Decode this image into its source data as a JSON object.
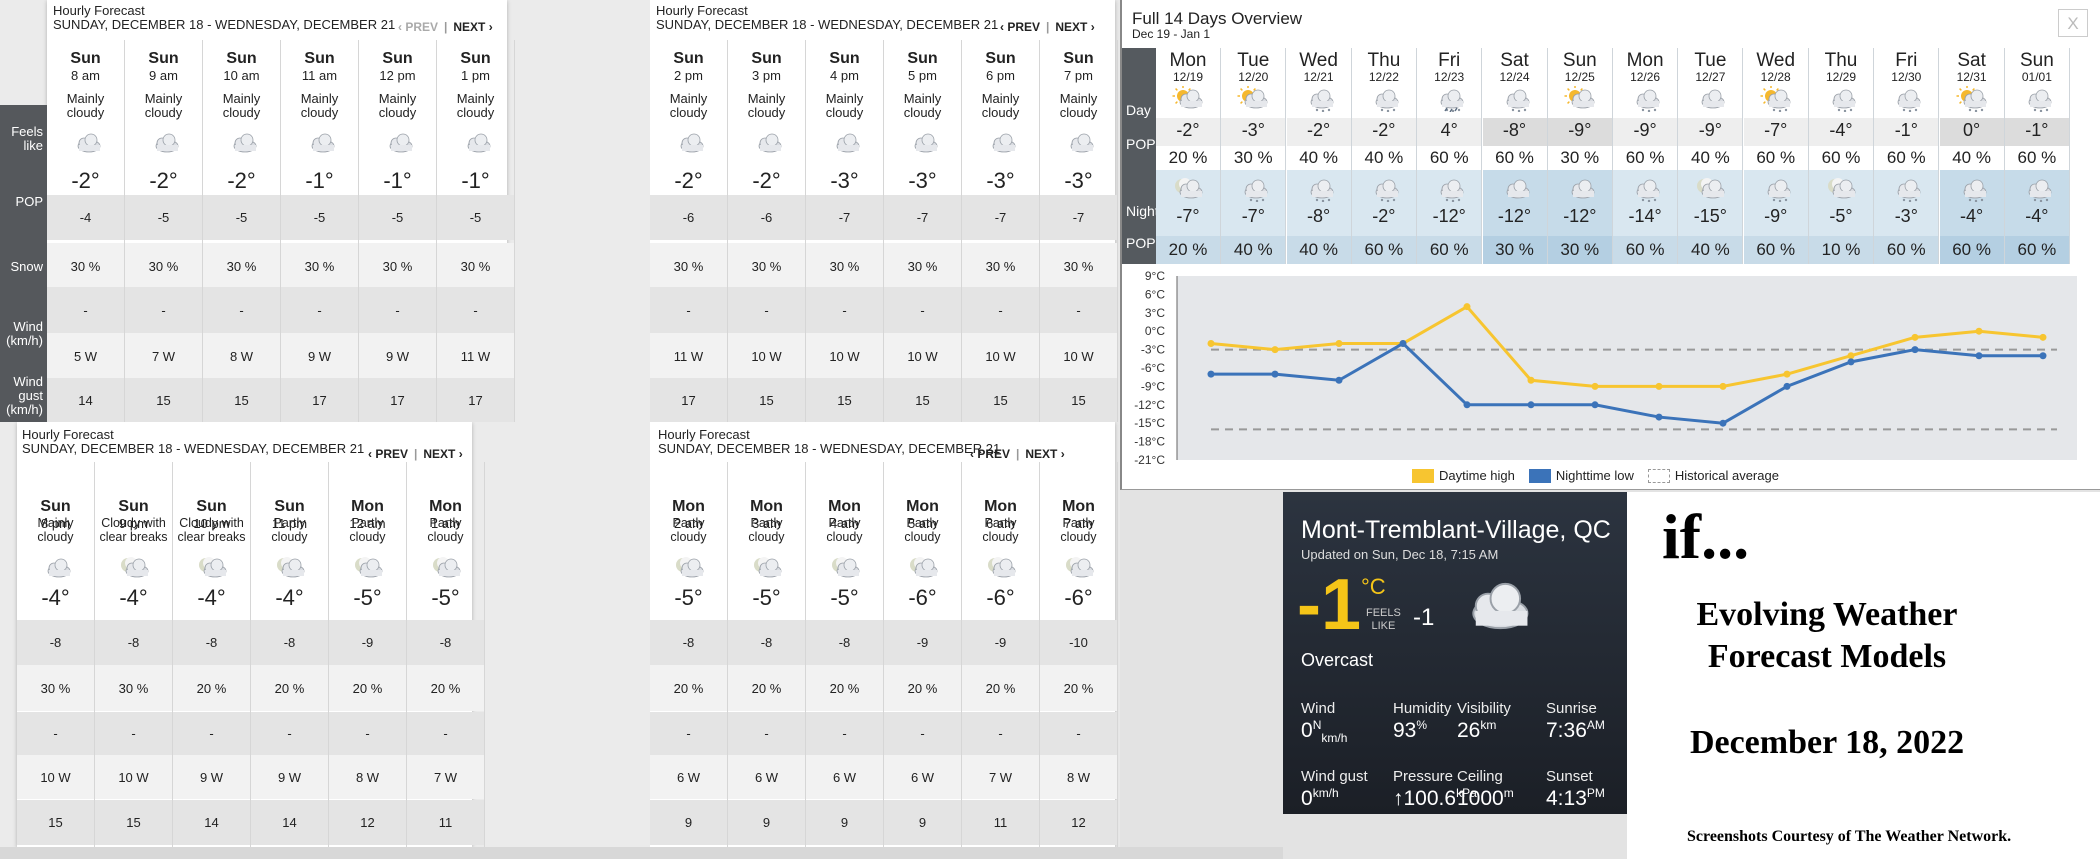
{
  "hourly_panels": [
    {
      "title": "Hourly Forecast",
      "date_range": "SUNDAY, DECEMBER 18 - WEDNESDAY, DECEMBER 21",
      "prev": "‹ PREV",
      "next": "NEXT ›",
      "prev_dim": true,
      "cols": [
        {
          "day": "Sun",
          "time": "8 am",
          "cond": [
            "Mainly",
            "cloudy"
          ],
          "temp": "-2°",
          "feels": "-4",
          "pop": "30 %",
          "snow": "-",
          "wind": "5 W",
          "gust": "14",
          "icon": "cloud-icon"
        },
        {
          "day": "Sun",
          "time": "9 am",
          "cond": [
            "Mainly",
            "cloudy"
          ],
          "temp": "-2°",
          "feels": "-5",
          "pop": "30 %",
          "snow": "-",
          "wind": "7 W",
          "gust": "15",
          "icon": "cloud-icon"
        },
        {
          "day": "Sun",
          "time": "10 am",
          "cond": [
            "Mainly",
            "cloudy"
          ],
          "temp": "-2°",
          "feels": "-5",
          "pop": "30 %",
          "snow": "-",
          "wind": "8 W",
          "gust": "15",
          "icon": "cloud-icon"
        },
        {
          "day": "Sun",
          "time": "11 am",
          "cond": [
            "Mainly",
            "cloudy"
          ],
          "temp": "-1°",
          "feels": "-5",
          "pop": "30 %",
          "snow": "-",
          "wind": "9 W",
          "gust": "17",
          "icon": "cloud-icon"
        },
        {
          "day": "Sun",
          "time": "12 pm",
          "cond": [
            "Mainly",
            "cloudy"
          ],
          "temp": "-1°",
          "feels": "-5",
          "pop": "30 %",
          "snow": "-",
          "wind": "9 W",
          "gust": "17",
          "icon": "cloud-icon"
        },
        {
          "day": "Sun",
          "time": "1 pm",
          "cond": [
            "Mainly",
            "cloudy"
          ],
          "temp": "-1°",
          "feels": "-5",
          "pop": "30 %",
          "snow": "-",
          "wind": "11 W",
          "gust": "17",
          "icon": "cloud-icon"
        }
      ]
    },
    {
      "title": "Hourly Forecast",
      "date_range": "SUNDAY, DECEMBER 18 - WEDNESDAY, DECEMBER 21",
      "prev": "‹ PREV",
      "next": "NEXT ›",
      "prev_dim": false,
      "cols": [
        {
          "day": "Sun",
          "time": "2 pm",
          "cond": [
            "Mainly",
            "cloudy"
          ],
          "temp": "-2°",
          "feels": "-6",
          "pop": "30 %",
          "snow": "-",
          "wind": "11 W",
          "gust": "17",
          "icon": "cloud-icon"
        },
        {
          "day": "Sun",
          "time": "3 pm",
          "cond": [
            "Mainly",
            "cloudy"
          ],
          "temp": "-2°",
          "feels": "-6",
          "pop": "30 %",
          "snow": "-",
          "wind": "10 W",
          "gust": "15",
          "icon": "cloud-icon"
        },
        {
          "day": "Sun",
          "time": "4 pm",
          "cond": [
            "Mainly",
            "cloudy"
          ],
          "temp": "-3°",
          "feels": "-7",
          "pop": "30 %",
          "snow": "-",
          "wind": "10 W",
          "gust": "15",
          "icon": "cloud-icon"
        },
        {
          "day": "Sun",
          "time": "5 pm",
          "cond": [
            "Mainly",
            "cloudy"
          ],
          "temp": "-3°",
          "feels": "-7",
          "pop": "30 %",
          "snow": "-",
          "wind": "10 W",
          "gust": "15",
          "icon": "cloud-icon"
        },
        {
          "day": "Sun",
          "time": "6 pm",
          "cond": [
            "Mainly",
            "cloudy"
          ],
          "temp": "-3°",
          "feels": "-7",
          "pop": "30 %",
          "snow": "-",
          "wind": "10 W",
          "gust": "15",
          "icon": "cloud-icon"
        },
        {
          "day": "Sun",
          "time": "7 pm",
          "cond": [
            "Mainly",
            "cloudy"
          ],
          "temp": "-3°",
          "feels": "-7",
          "pop": "30 %",
          "snow": "-",
          "wind": "10 W",
          "gust": "15",
          "icon": "cloud-icon"
        }
      ]
    },
    {
      "title": "Hourly Forecast",
      "date_range": "SUNDAY, DECEMBER 18 - WEDNESDAY, DECEMBER 21",
      "prev": "‹ PREV",
      "next": "NEXT ›",
      "prev_dim": false,
      "cols": [
        {
          "day": "Sun",
          "time": "8 pm",
          "cond": [
            "Mainly",
            "cloudy"
          ],
          "temp": "-4°",
          "feels": "-8",
          "pop": "30 %",
          "snow": "-",
          "wind": "10 W",
          "gust": "15",
          "icon": "cloud-icon"
        },
        {
          "day": "Sun",
          "time": "9 pm",
          "cond": [
            "Cloudy with",
            "clear breaks"
          ],
          "temp": "-4°",
          "feels": "-8",
          "pop": "30 %",
          "snow": "-",
          "wind": "10 W",
          "gust": "15",
          "icon": "moon-cloud-icon"
        },
        {
          "day": "Sun",
          "time": "10 pm",
          "cond": [
            "Cloudy with",
            "clear breaks"
          ],
          "temp": "-4°",
          "feels": "-8",
          "pop": "20 %",
          "snow": "-",
          "wind": "9 W",
          "gust": "14",
          "icon": "moon-cloud-icon"
        },
        {
          "day": "Sun",
          "time": "11 pm",
          "cond": [
            "Partly",
            "cloudy"
          ],
          "temp": "-4°",
          "feels": "-8",
          "pop": "20 %",
          "snow": "-",
          "wind": "9 W",
          "gust": "14",
          "icon": "moon-cloud-icon"
        },
        {
          "day": "Mon",
          "time": "12 am",
          "cond": [
            "Partly",
            "cloudy"
          ],
          "temp": "-5°",
          "feels": "-9",
          "pop": "20 %",
          "snow": "-",
          "wind": "8 W",
          "gust": "12",
          "icon": "moon-cloud-icon"
        },
        {
          "day": "Mon",
          "time": "1 am",
          "cond": [
            "Partly",
            "cloudy"
          ],
          "temp": "-5°",
          "feels": "-8",
          "pop": "20 %",
          "snow": "-",
          "wind": "7 W",
          "gust": "11",
          "icon": "moon-cloud-icon"
        }
      ]
    },
    {
      "title": "Hourly Forecast",
      "date_range": "SUNDAY, DECEMBER 18 - WEDNESDAY, DECEMBER 21",
      "prev": "‹ PREV",
      "next": "NEXT ›",
      "prev_dim": false,
      "cols": [
        {
          "day": "Mon",
          "time": "2 am",
          "cond": [
            "Partly",
            "cloudy"
          ],
          "temp": "-5°",
          "feels": "-8",
          "pop": "20 %",
          "snow": "-",
          "wind": "6 W",
          "gust": "9",
          "icon": "moon-cloud-icon"
        },
        {
          "day": "Mon",
          "time": "3 am",
          "cond": [
            "Partly",
            "cloudy"
          ],
          "temp": "-5°",
          "feels": "-8",
          "pop": "20 %",
          "snow": "-",
          "wind": "6 W",
          "gust": "9",
          "icon": "moon-cloud-icon"
        },
        {
          "day": "Mon",
          "time": "4 am",
          "cond": [
            "Partly",
            "cloudy"
          ],
          "temp": "-5°",
          "feels": "-8",
          "pop": "20 %",
          "snow": "-",
          "wind": "6 W",
          "gust": "9",
          "icon": "moon-cloud-icon"
        },
        {
          "day": "Mon",
          "time": "5 am",
          "cond": [
            "Partly",
            "cloudy"
          ],
          "temp": "-6°",
          "feels": "-9",
          "pop": "20 %",
          "snow": "-",
          "wind": "6 W",
          "gust": "9",
          "icon": "moon-cloud-icon"
        },
        {
          "day": "Mon",
          "time": "6 am",
          "cond": [
            "Partly",
            "cloudy"
          ],
          "temp": "-6°",
          "feels": "-9",
          "pop": "20 %",
          "snow": "-",
          "wind": "7 W",
          "gust": "11",
          "icon": "moon-cloud-icon"
        },
        {
          "day": "Mon",
          "time": "7 am",
          "cond": [
            "Partly",
            "cloudy"
          ],
          "temp": "-6°",
          "feels": "-10",
          "pop": "20 %",
          "snow": "-",
          "wind": "8 W",
          "gust": "12",
          "icon": "moon-cloud-icon"
        }
      ]
    }
  ],
  "row_labels": {
    "feels": [
      "Feels",
      "like"
    ],
    "pop": "POP",
    "snow": "Snow",
    "wind": [
      "Wind",
      "(km/h)"
    ],
    "gust": [
      "Wind",
      "gust",
      "(km/h)"
    ]
  },
  "overview": {
    "title": "Full 14 Days Overview",
    "subtitle": "Dec 19 - Jan 1",
    "close": "X",
    "day_label": "Day",
    "night_label": "Night",
    "pop_label": "POP",
    "days": [
      {
        "dn": "Mon",
        "dt": "12/19",
        "hi": "-2°",
        "dpop": "20 %",
        "lo": "-7°",
        "npop": "20 %",
        "dicon": "sun-cloud-icon",
        "nicon": "moon-cloud-icon"
      },
      {
        "dn": "Tue",
        "dt": "12/20",
        "hi": "-3°",
        "dpop": "30 %",
        "lo": "-7°",
        "npop": "40 %",
        "dicon": "sun-cloud-icon",
        "nicon": "snow-cloud-icon"
      },
      {
        "dn": "Wed",
        "dt": "12/21",
        "hi": "-2°",
        "dpop": "40 %",
        "lo": "-8°",
        "npop": "40 %",
        "dicon": "snow-cloud-icon",
        "nicon": "snow-cloud-icon"
      },
      {
        "dn": "Thu",
        "dt": "12/22",
        "hi": "-2°",
        "dpop": "40 %",
        "lo": "-2°",
        "npop": "60 %",
        "dicon": "snow-cloud-icon",
        "nicon": "snow-cloud-icon"
      },
      {
        "dn": "Fri",
        "dt": "12/23",
        "hi": "4°",
        "dpop": "60 %",
        "lo": "-12°",
        "npop": "60 %",
        "dicon": "rain-snow-cloud-icon",
        "nicon": "snow-cloud-icon"
      },
      {
        "dn": "Sat",
        "dt": "12/24",
        "hi": "-8°",
        "dpop": "60 %",
        "lo": "-12°",
        "npop": "30 %",
        "dicon": "snow-cloud-icon",
        "nicon": "cloud-icon"
      },
      {
        "dn": "Sun",
        "dt": "12/25",
        "hi": "-9°",
        "dpop": "30 %",
        "lo": "-12°",
        "npop": "30 %",
        "dicon": "sun-cloud-icon",
        "nicon": "cloud-icon"
      },
      {
        "dn": "Mon",
        "dt": "12/26",
        "hi": "-9°",
        "dpop": "60 %",
        "lo": "-14°",
        "npop": "60 %",
        "dicon": "snow-cloud-icon",
        "nicon": "snow-cloud-icon"
      },
      {
        "dn": "Tue",
        "dt": "12/27",
        "hi": "-9°",
        "dpop": "40 %",
        "lo": "-15°",
        "npop": "40 %",
        "dicon": "cloud-icon",
        "nicon": "moon-cloud-icon"
      },
      {
        "dn": "Wed",
        "dt": "12/28",
        "hi": "-7°",
        "dpop": "60 %",
        "lo": "-9°",
        "npop": "60 %",
        "dicon": "sun-snow-cloud-icon",
        "nicon": "snow-cloud-icon"
      },
      {
        "dn": "Thu",
        "dt": "12/29",
        "hi": "-4°",
        "dpop": "60 %",
        "lo": "-5°",
        "npop": "10 %",
        "dicon": "snow-cloud-icon",
        "nicon": "moon-cloud-icon"
      },
      {
        "dn": "Fri",
        "dt": "12/30",
        "hi": "-1°",
        "dpop": "60 %",
        "lo": "-3°",
        "npop": "60 %",
        "dicon": "snow-cloud-icon",
        "nicon": "snow-cloud-icon"
      },
      {
        "dn": "Sat",
        "dt": "12/31",
        "hi": "0°",
        "dpop": "40 %",
        "lo": "-4°",
        "npop": "60 %",
        "dicon": "sun-snow-cloud-icon",
        "nicon": "snow-cloud-icon"
      },
      {
        "dn": "Sun",
        "dt": "01/01",
        "hi": "-1°",
        "dpop": "60 %",
        "lo": "-4°",
        "npop": "60 %",
        "dicon": "snow-cloud-icon",
        "nicon": "snow-cloud-icon"
      }
    ]
  },
  "chart_data": {
    "type": "line",
    "x": [
      "12/19",
      "12/20",
      "12/21",
      "12/22",
      "12/23",
      "12/24",
      "12/25",
      "12/26",
      "12/27",
      "12/28",
      "12/29",
      "12/30",
      "12/31",
      "01/01"
    ],
    "yticks": [
      "9°C",
      "6°C",
      "3°C",
      "0°C",
      "-3°C",
      "-6°C",
      "-9°C",
      "-12°C",
      "-15°C",
      "-18°C",
      "-21°C"
    ],
    "ylim": [
      -21,
      9
    ],
    "series": [
      {
        "name": "Daytime high",
        "color": "#f7c530",
        "values": [
          -2,
          -3,
          -2,
          -2,
          4,
          -8,
          -9,
          -9,
          -9,
          -7,
          -4,
          -1,
          0,
          -1
        ]
      },
      {
        "name": "Nighttime low",
        "color": "#3b73b9",
        "values": [
          -7,
          -7,
          -8,
          -2,
          -12,
          -12,
          -12,
          -14,
          -15,
          -9,
          -5,
          -3,
          -4,
          -4
        ]
      }
    ],
    "historical_average": {
      "name": "Historical average",
      "values": [
        -3,
        -16
      ]
    },
    "grid": true,
    "legend": "bottom"
  },
  "current": {
    "location": "Mont-Tremblant-Village, QC",
    "updated": "Updated on Sun, Dec 18, 7:15 AM",
    "temp": "-1",
    "unit": "°C",
    "feels_label": [
      "FEELS",
      "LIKE"
    ],
    "feels": "-1",
    "condition": "Overcast",
    "stats": [
      {
        "k": "Wind",
        "v": "0",
        "u": "N",
        "u2": "km/h"
      },
      {
        "k": "Humidity",
        "v": "93",
        "u": "%",
        "u2": ""
      },
      {
        "k": "Visibility",
        "v": "26",
        "u": "km",
        "u2": ""
      },
      {
        "k": "Sunrise",
        "v": "7:36",
        "u": "AM",
        "u2": ""
      },
      {
        "k": "Wind gust",
        "v": "0",
        "u": "km/h",
        "u2": ""
      },
      {
        "k": "Pressure",
        "v": "↑100.6",
        "u": "kPa",
        "u2": ""
      },
      {
        "k": "Ceiling",
        "v": "1000",
        "u": "m",
        "u2": ""
      },
      {
        "k": "Sunset",
        "v": "4:13",
        "u": "PM",
        "u2": ""
      }
    ]
  },
  "side": {
    "if": "if...",
    "line1": "Evolving Weather",
    "line2": "Forecast Models",
    "date": "December 18, 2022",
    "credit": "Screenshots Courtesy of The Weather Network."
  }
}
